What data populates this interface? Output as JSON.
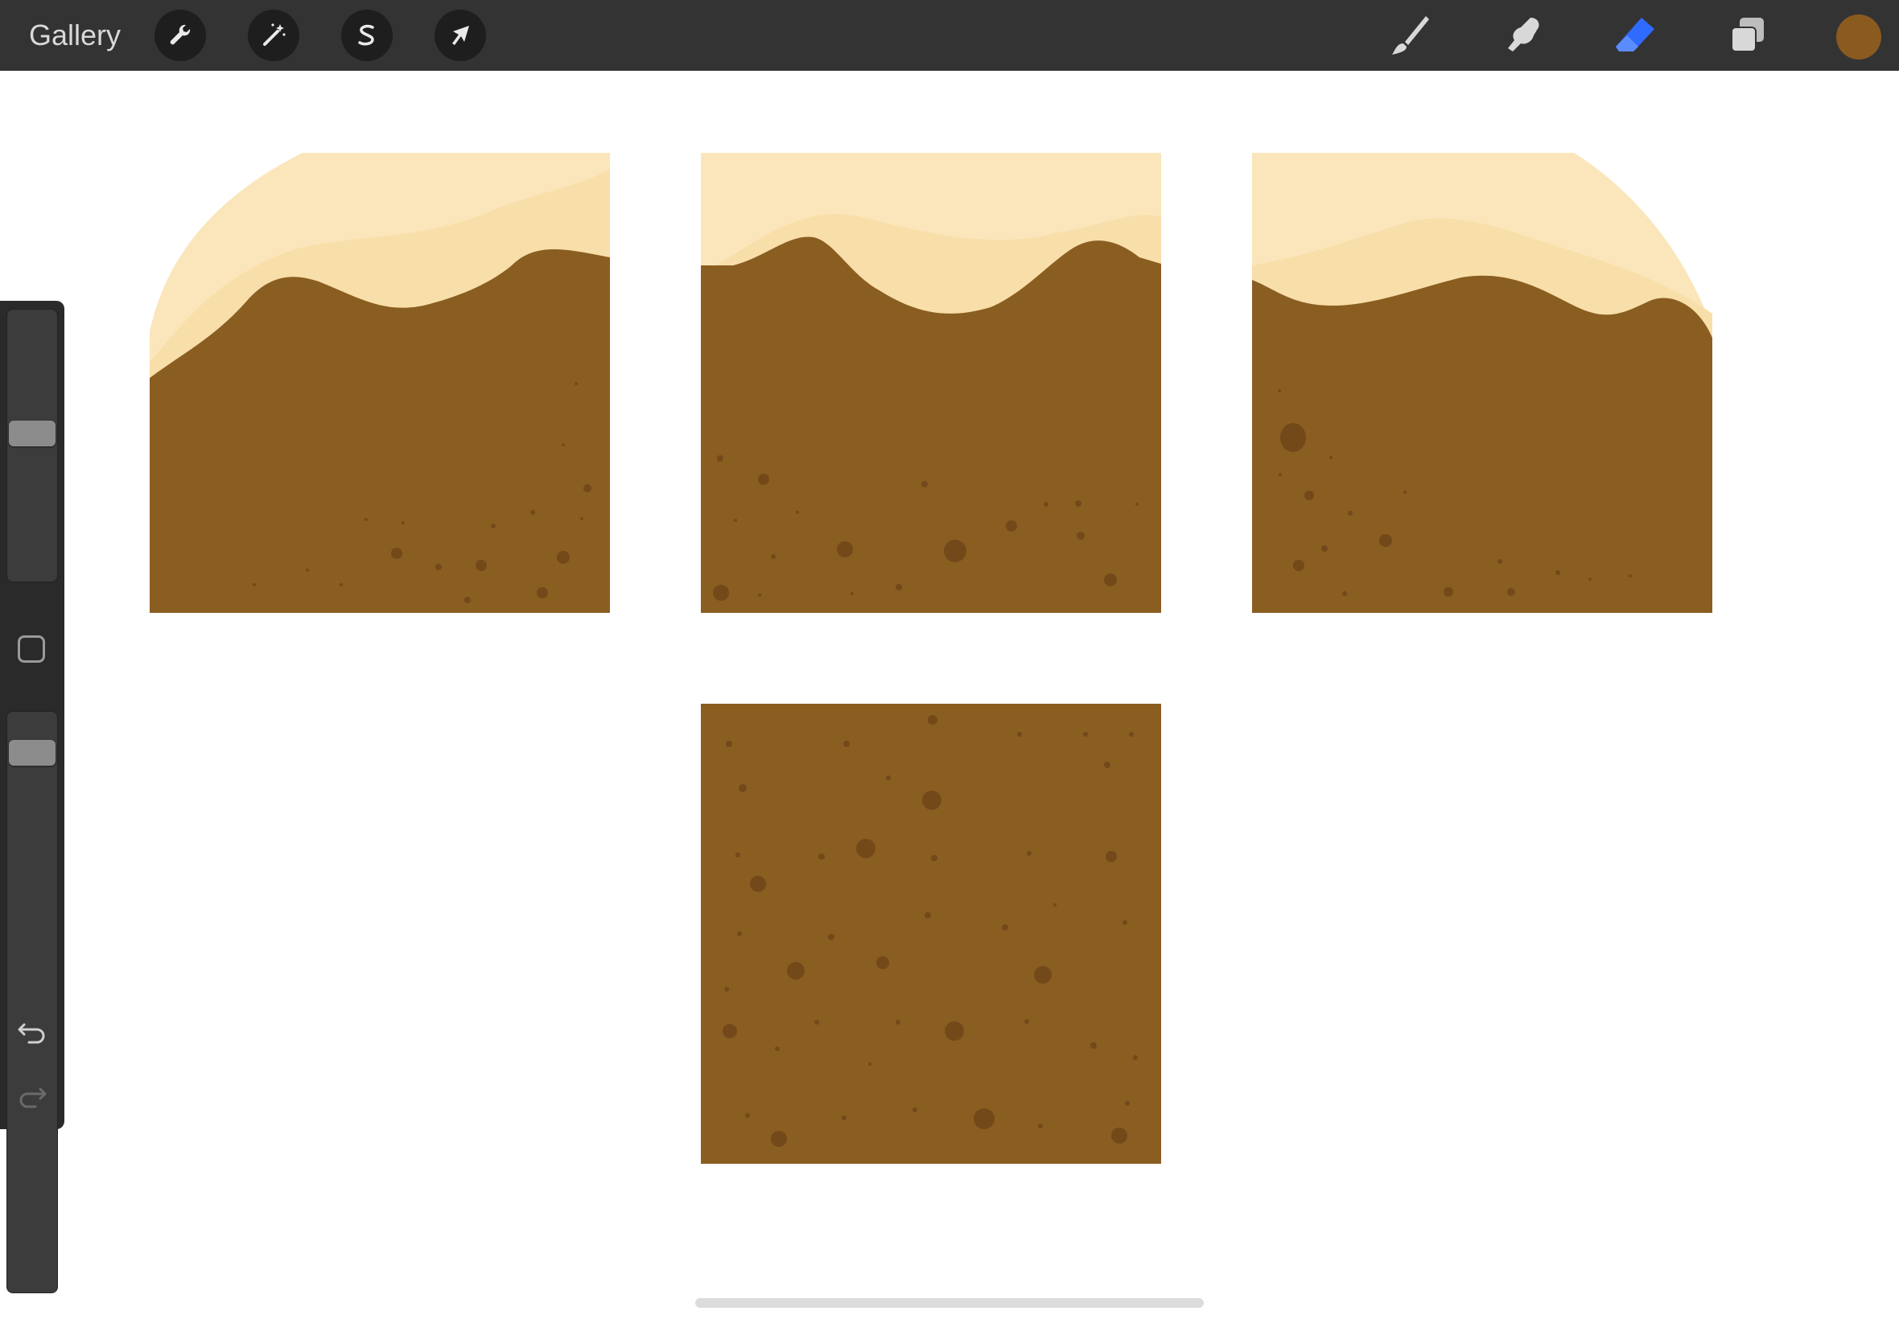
{
  "topbar": {
    "gallery_label": "Gallery",
    "left_tools": [
      {
        "name": "actions",
        "icon": "wrench-icon"
      },
      {
        "name": "adjustments",
        "icon": "magic-wand-icon"
      },
      {
        "name": "selection",
        "icon": "selection-s-icon"
      },
      {
        "name": "transform",
        "icon": "arrow-cursor-icon"
      }
    ],
    "right_tools": [
      {
        "name": "brush",
        "icon": "brush-icon",
        "active": false
      },
      {
        "name": "smudge",
        "icon": "smudge-icon",
        "active": false
      },
      {
        "name": "eraser",
        "icon": "eraser-icon",
        "active": true
      },
      {
        "name": "layers",
        "icon": "layers-icon",
        "active": false
      }
    ],
    "current_color": "#8a5a1e",
    "active_tool_color": "#2f6bff"
  },
  "sidebar": {
    "brush_size_level": 0.55,
    "opacity_level": 0.05,
    "icons": [
      "modify-square-icon",
      "undo-icon",
      "redo-icon"
    ]
  },
  "canvas": {
    "colors": {
      "dirt": "#8a5d21",
      "dirt_speck": "#74491a",
      "sand_light": "#fbe6bb",
      "sand_mid": "#f8dea9"
    },
    "tiles": [
      "dirt-tile-top-left",
      "dirt-tile-top-center",
      "dirt-tile-top-right",
      "dirt-tile-fill"
    ]
  }
}
